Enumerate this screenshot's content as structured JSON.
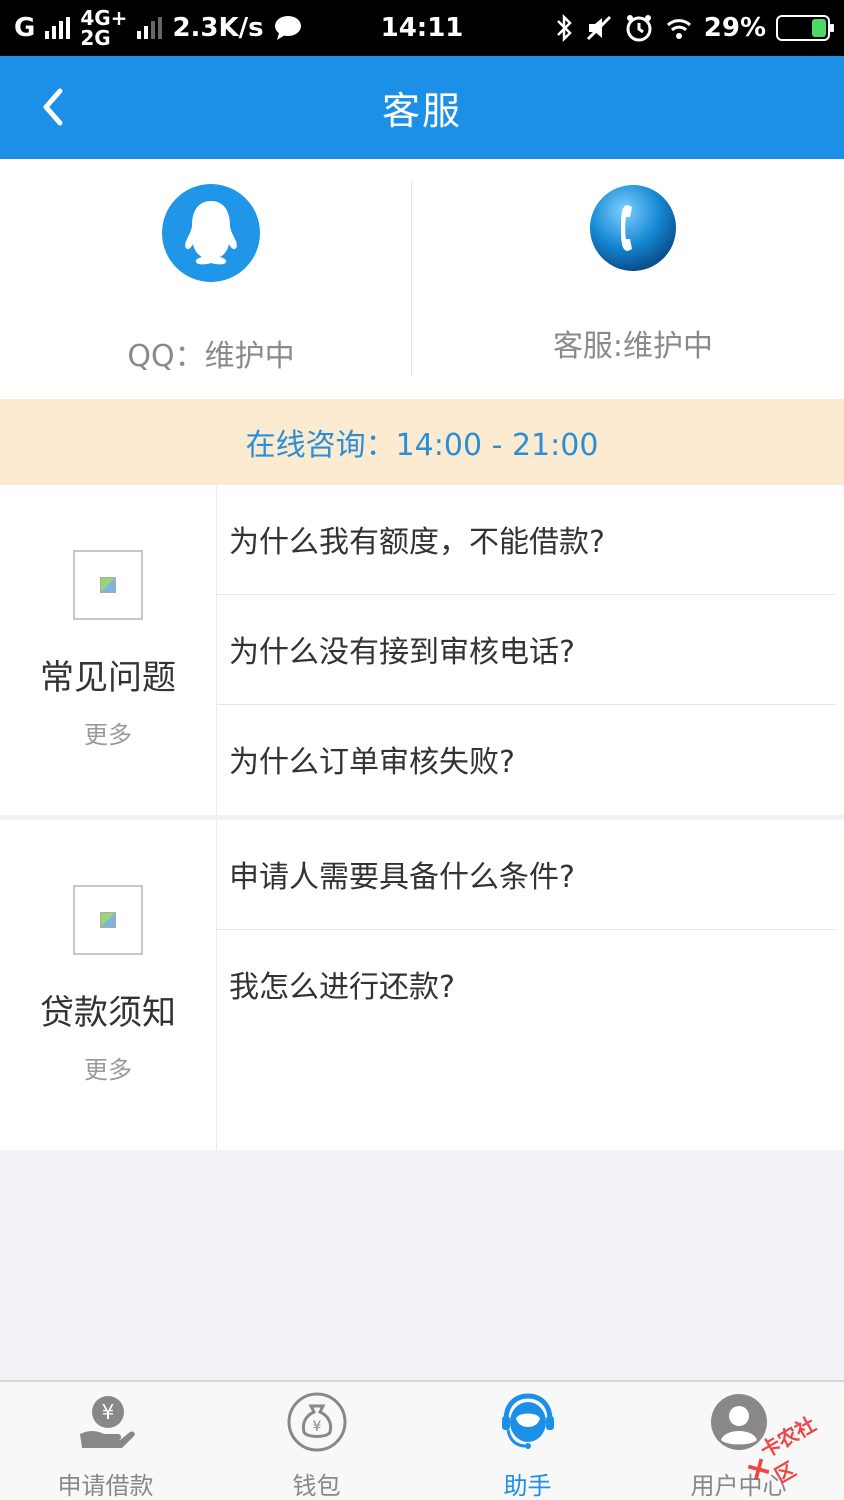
{
  "status_bar": {
    "carrier1": "G",
    "net_top": "4G+",
    "net_bottom": "2G",
    "speed": "2.3K/s",
    "time": "14:11",
    "battery": "29%"
  },
  "header": {
    "title": "客服"
  },
  "contact": {
    "qq_label": "QQ：维护中",
    "service_label": "客服:维护中"
  },
  "online": {
    "text": "在线咨询：14:00 - 21:00"
  },
  "faq": {
    "title": "常见问题",
    "more": "更多",
    "questions": [
      "为什么我有额度，不能借款?",
      "为什么没有接到审核电话?",
      "为什么订单审核失败?"
    ]
  },
  "loan": {
    "title": "贷款须知",
    "more": "更多",
    "questions": [
      "申请人需要具备什么条件?",
      "我怎么进行还款?"
    ]
  },
  "nav": {
    "items": [
      {
        "label": "申请借款",
        "icon": "loan-hand-icon"
      },
      {
        "label": "钱包",
        "icon": "money-bag-icon"
      },
      {
        "label": "助手",
        "icon": "assistant-headset-icon"
      },
      {
        "label": "用户中心",
        "icon": "user-avatar-icon"
      }
    ],
    "active_color": "#1c8fe6"
  },
  "watermark": {
    "text": "卡农社区"
  },
  "colors": {
    "header": "#1c8fe6",
    "online_bg": "#fcebd0",
    "online_text": "#2a8fd6"
  }
}
